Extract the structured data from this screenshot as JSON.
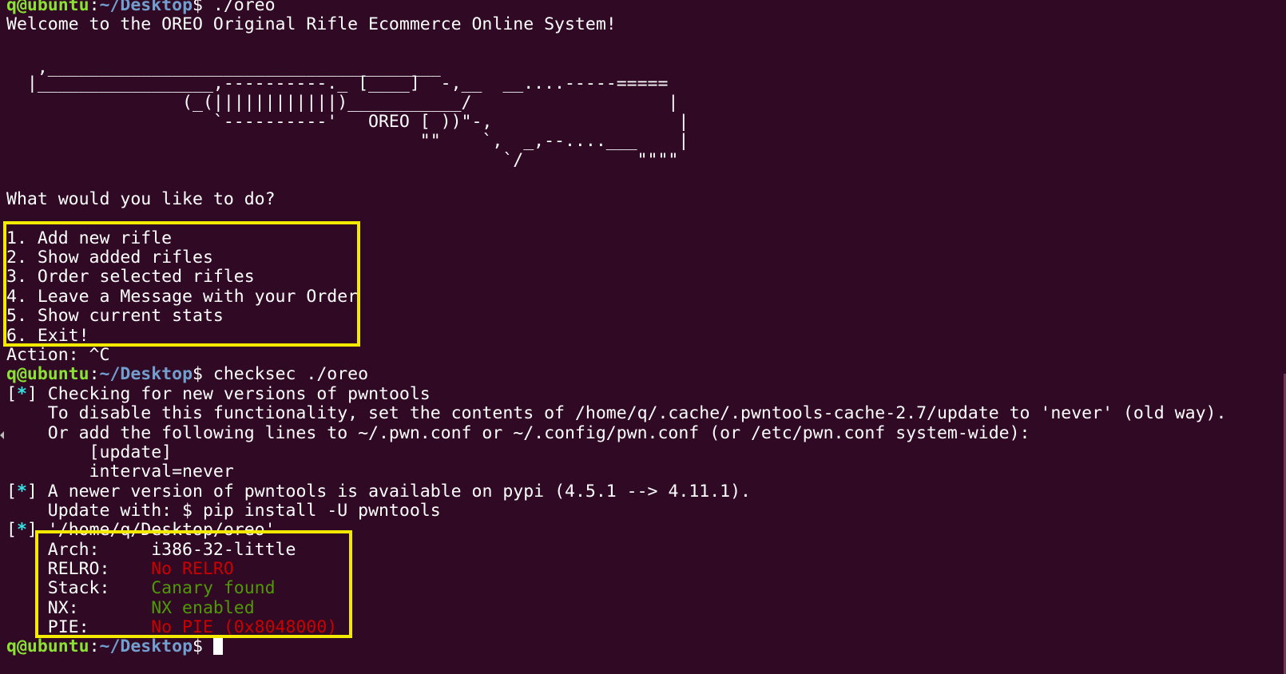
{
  "prompt": {
    "user_host": "q@ubuntu",
    "path": "~/Desktop",
    "dollar": "$ "
  },
  "commands": {
    "run": "./oreo",
    "checksec": "checksec ./oreo"
  },
  "program": {
    "welcome": "Welcome to the OREO Original Rifle Ecommerce Online System!",
    "ascii_art": [
      "   ,______________________________________",
      "  |_________________,----------._ [____]  -,__  __....-----=====",
      "                 (_(||||||||||||)___________/                   |",
      "                    `----------'   OREO [ ))\"-,                  |",
      "                                        \"\"    `,  _,--....___    |",
      "                                                `/           \"\"\"\""
    ],
    "question": "What would you like to do?",
    "menu": [
      "1. Add new rifle",
      "2. Show added rifles",
      "3. Order selected rifles",
      "4. Leave a Message with your Order",
      "5. Show current stats",
      "6. Exit!"
    ],
    "action": "Action: ^C"
  },
  "checksec_output": {
    "star": "*",
    "check_line": " Checking for new versions of pwntools",
    "disable_line": "    To disable this functionality, set the contents of /home/q/.cache/.pwntools-cache-2.7/update to 'never' (old way).",
    "or_line": "    Or add the following lines to ~/.pwn.conf or ~/.config/pwn.conf (or /etc/pwn.conf system-wide):",
    "update_line": "        [update]",
    "interval_line": "        interval=never",
    "newer_line": " A newer version of pwntools is available on pypi (4.5.1 --> 4.11.1).",
    "pip_line": "    Update with: $ pip install -U pwntools",
    "file_line": " '/home/q/Desktop/oreo'",
    "props": [
      {
        "label": "    Arch:     ",
        "value": "i386-32-little",
        "color": "#ffffff"
      },
      {
        "label": "    RELRO:    ",
        "value": "No RELRO",
        "color": "#cc0000"
      },
      {
        "label": "    Stack:    ",
        "value": "Canary found",
        "color": "#4e9a06"
      },
      {
        "label": "    NX:       ",
        "value": "NX enabled",
        "color": "#4e9a06"
      },
      {
        "label": "    PIE:      ",
        "value": "No PIE (0x8048000)",
        "color": "#cc0000"
      }
    ]
  },
  "colors": {
    "background": "#300a24",
    "highlight_box": "#f4ea00",
    "prompt_user": "#8ae234",
    "prompt_path": "#729fcf"
  }
}
